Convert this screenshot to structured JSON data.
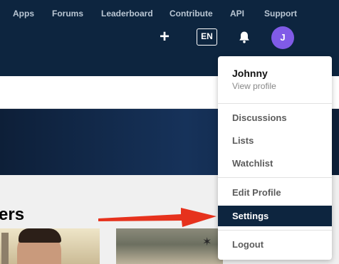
{
  "nav": {
    "links": [
      "Apps",
      "Forums",
      "Leaderboard",
      "Contribute",
      "API",
      "Support"
    ],
    "add_icon": "+",
    "language": "EN",
    "bell_icon": "bell-icon",
    "avatar_initial": "J"
  },
  "section": {
    "heading_visible_text": "ers"
  },
  "user_menu": {
    "username": "Johnny",
    "view_profile": "View profile",
    "items": [
      "Discussions",
      "Lists",
      "Watchlist",
      "Edit Profile",
      "Settings",
      "Logout"
    ],
    "highlighted_item": "Settings"
  },
  "colors": {
    "navbar": "#0d253f",
    "avatar": "#805be7",
    "highlight": "#0d253f",
    "arrow": "#e6321d"
  }
}
